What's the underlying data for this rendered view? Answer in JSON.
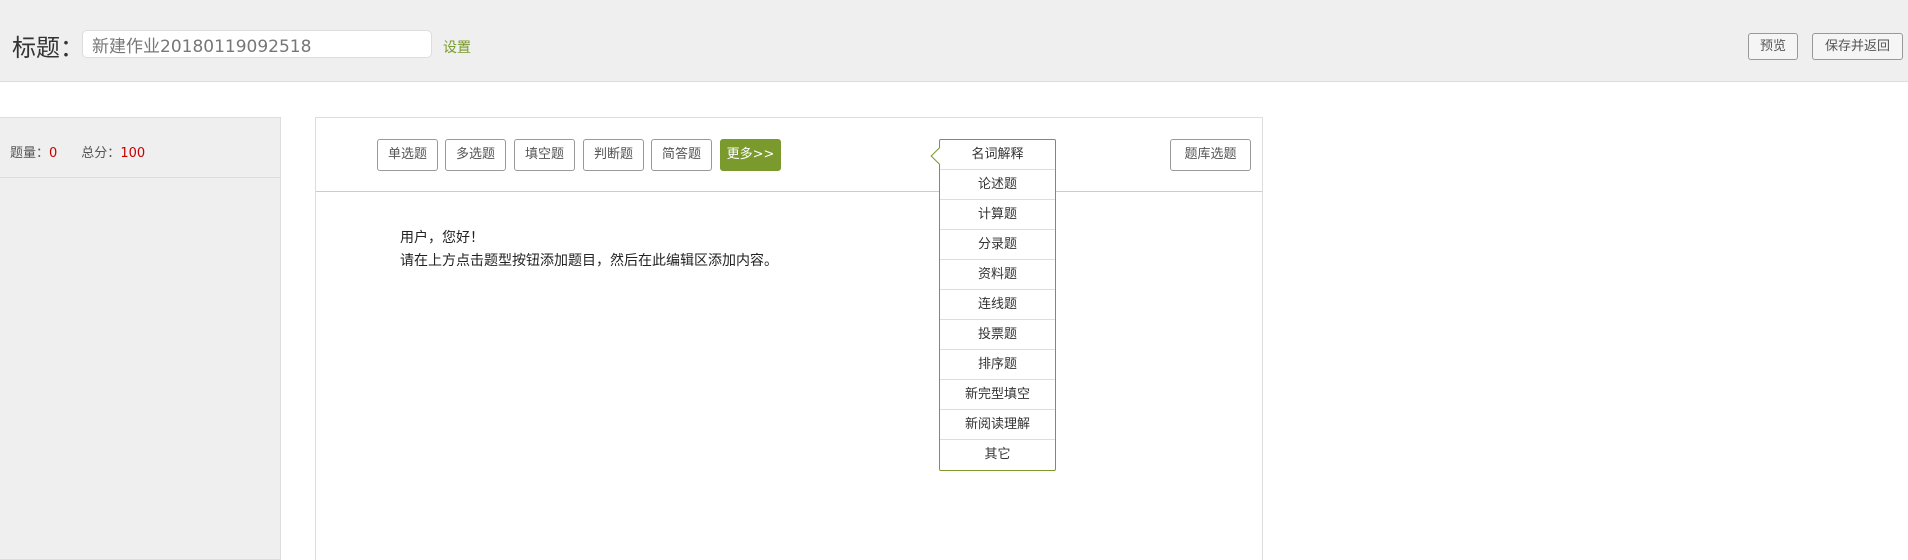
{
  "header": {
    "title_label": "标题：",
    "title_value": "新建作业20180119092518",
    "settings": "设置",
    "preview": "预览",
    "save_return": "保存并返回"
  },
  "stats": {
    "count_label": "题量：",
    "count": "0",
    "score_label": "总分：",
    "score": "100"
  },
  "toolbar": {
    "buttons": [
      "单选题",
      "多选题",
      "填空题",
      "判断题",
      "简答题"
    ],
    "more": "更多>>",
    "bank": "题库选题"
  },
  "more_menu": [
    "名词解释",
    "论述题",
    "计算题",
    "分录题",
    "资料题",
    "连线题",
    "投票题",
    "排序题",
    "新完型填空",
    "新阅读理解",
    "其它"
  ],
  "content": {
    "greeting": "用户，您好！",
    "instruction": "请在上方点击题型按钮添加题目，然后在此编辑区添加内容。"
  },
  "colors": {
    "accent": "#7a9a2e",
    "number": "#c40000"
  }
}
